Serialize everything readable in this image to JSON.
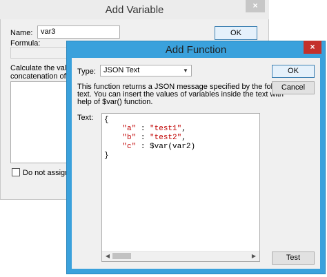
{
  "back_dialog": {
    "title": "Add Variable",
    "close_glyph": "×",
    "name_label": "Name:",
    "name_value": "var3",
    "ok_label": "OK",
    "formula_label": "Formula:",
    "desc_line1": "Calculate the value",
    "desc_line2": "concatenation of th",
    "checkbox_label": "Do not assign va"
  },
  "front_dialog": {
    "title": "Add Function",
    "close_glyph": "×",
    "type_label": "Type:",
    "type_value": "JSON Text",
    "type_arrow_icon": "▼",
    "description": "This function returns a JSON message specified by the following\ntext. You can insert the values of variables inside the text with\nhelp of $var() function.",
    "text_label": "Text:",
    "code": {
      "line1": "{",
      "k_a": "\"a\"",
      "v_a": "\"test1\"",
      "k_b": "\"b\"",
      "v_b": "\"test2\"",
      "k_c": "\"c\"",
      "v_c": "$var(var2)",
      "sep": " : ",
      "comma": ",",
      "indent": "    ",
      "line_end": "}"
    },
    "scroll_left_icon": "◀",
    "scroll_right_icon": "▶",
    "ok_label": "OK",
    "cancel_label": "Cancel",
    "test_label": "Test"
  },
  "colors": {
    "accent_frame": "#3aa1dc",
    "close_red": "#c4302b",
    "code_string": "#c00000"
  }
}
